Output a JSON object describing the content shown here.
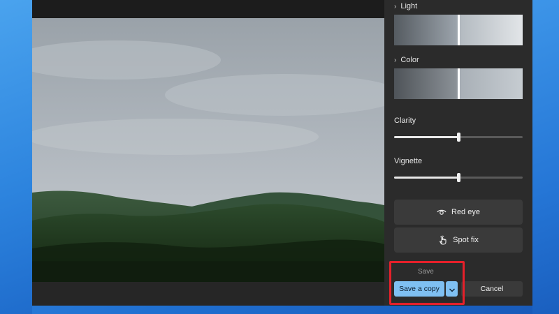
{
  "panel": {
    "light": {
      "label": "Light",
      "icon": "chevron-right-icon"
    },
    "color": {
      "label": "Color",
      "icon": "chevron-right-icon"
    },
    "clarity": {
      "label": "Clarity",
      "value": 0.5
    },
    "vignette": {
      "label": "Vignette",
      "value": 0.5
    },
    "red_eye": {
      "label": "Red eye",
      "icon": "eye-icon"
    },
    "spot_fix": {
      "label": "Spot fix",
      "icon": "touch-hand-icon"
    }
  },
  "footer": {
    "save_label": "Save",
    "save_copy_label": "Save a copy",
    "dropdown_icon": "chevron-down-icon",
    "cancel_label": "Cancel"
  },
  "colors": {
    "accent": "#7fc0f2",
    "highlight": "#e5202a",
    "panel_bg": "#2b2b2b"
  }
}
